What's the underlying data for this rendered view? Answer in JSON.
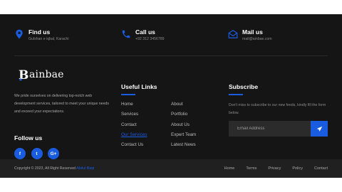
{
  "colors": {
    "accent": "#1a5ce0",
    "background": "#151515",
    "bottombar": "#202020"
  },
  "contacts": [
    {
      "icon": "map-pin-icon",
      "title": "Find us",
      "detail": "Gulshan e iqbal, Karachi"
    },
    {
      "icon": "phone-icon",
      "title": "Call us",
      "detail": "+92 312 3456789"
    },
    {
      "icon": "envelope-icon",
      "title": "Mail us",
      "detail": "mail@ainbae.com"
    }
  ],
  "brand": {
    "mark": "B",
    "name": "ainbae"
  },
  "about": "We pride ourselves on delivering top-notch web development services, tailored to meet your unique needs and exceed your expectations.",
  "follow": {
    "title": "Follow us",
    "networks": [
      {
        "icon": "facebook-icon",
        "glyph": "f"
      },
      {
        "icon": "twitter-icon",
        "glyph": "t"
      },
      {
        "icon": "google-plus-icon",
        "glyph": "G+"
      }
    ]
  },
  "useful_links": {
    "title": "Useful Links",
    "col1": [
      "Home",
      "Services",
      "Contact",
      "Our Services",
      "Contact Us"
    ],
    "col2": [
      "About",
      "Portfolio",
      "About Us",
      "Expert Team",
      "Latest News"
    ],
    "active": "Our Services"
  },
  "subscribe": {
    "title": "Subscribe",
    "text": "Don't miss to subscribe to our new feeds, kindly fill the form below.",
    "placeholder": "Email Address",
    "button_icon": "send-icon"
  },
  "bottom": {
    "copyright": "Copyright © 2023, All Right Reserved",
    "copyright_link": "Abdul Baqi",
    "nav": [
      "Home",
      "Terms",
      "Privacy",
      "Policy",
      "Contact"
    ]
  }
}
